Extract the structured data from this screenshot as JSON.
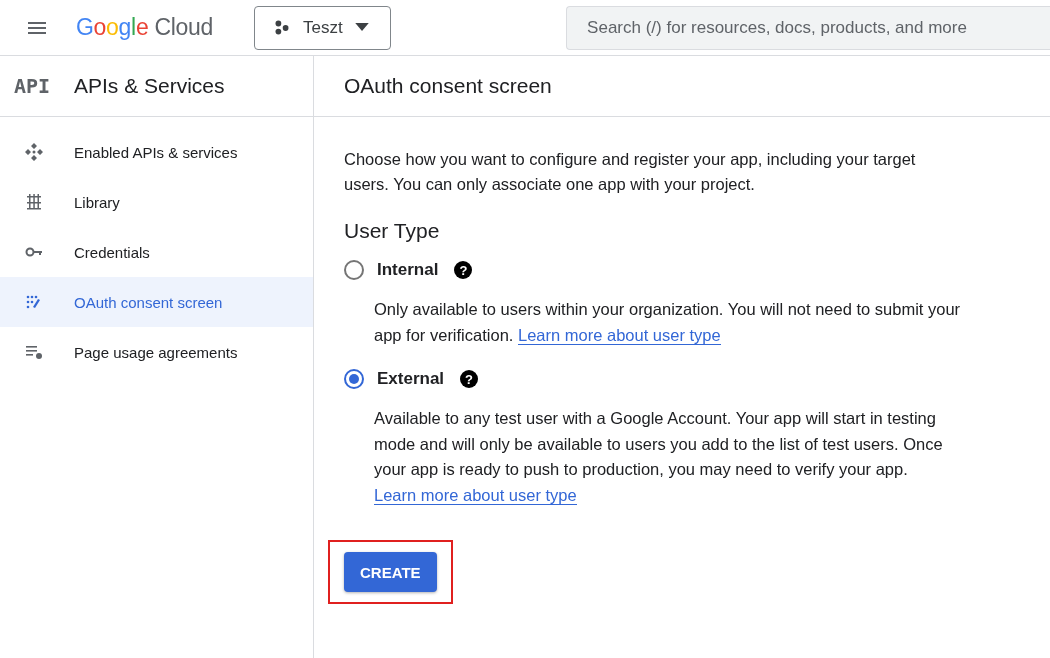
{
  "topbar": {
    "logo": {
      "brand": "Google",
      "product": "Cloud"
    },
    "project": "Teszt",
    "search": {
      "placeholder": "Search (/) for resources, docs, products, and more"
    }
  },
  "sidebar": {
    "badge": "API",
    "title": "APIs & Services",
    "items": [
      {
        "label": "Enabled APIs & services",
        "kind": "apis",
        "selected": false
      },
      {
        "label": "Library",
        "kind": "library",
        "selected": false
      },
      {
        "label": "Credentials",
        "kind": "key",
        "selected": false
      },
      {
        "label": "OAuth consent screen",
        "kind": "consent",
        "selected": true
      },
      {
        "label": "Page usage agreements",
        "kind": "agreements",
        "selected": false
      }
    ]
  },
  "page": {
    "title": "OAuth consent screen",
    "intro": "Choose how you want to configure and register your app, including your target users. You can only associate one app with your project.",
    "section": "User Type",
    "options": [
      {
        "label": "Internal",
        "help": "?",
        "selected": false,
        "description": "Only available to users within your organization. You will not need to submit your app for verification.",
        "link": "Learn more about user type"
      },
      {
        "label": "External",
        "help": "?",
        "selected": true,
        "description": "Available to any test user with a Google Account. Your app will start in testing mode and will only be available to users you add to the list of test users. Once your app is ready to push to production, you may need to verify your app.",
        "link": "Learn more about user type"
      }
    ],
    "button": {
      "label": "CREATE",
      "highlighted": true
    }
  }
}
